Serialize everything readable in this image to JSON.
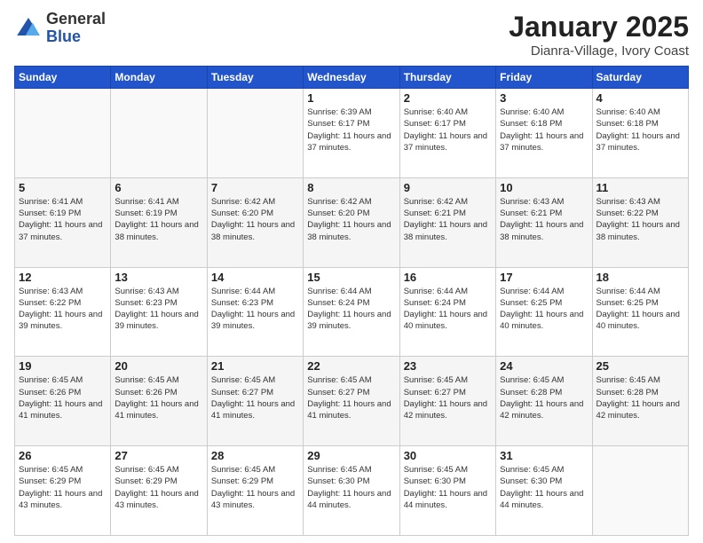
{
  "logo": {
    "general": "General",
    "blue": "Blue"
  },
  "header": {
    "month": "January 2025",
    "location": "Dianra-Village, Ivory Coast"
  },
  "days_of_week": [
    "Sunday",
    "Monday",
    "Tuesday",
    "Wednesday",
    "Thursday",
    "Friday",
    "Saturday"
  ],
  "weeks": [
    [
      {
        "day": "",
        "info": ""
      },
      {
        "day": "",
        "info": ""
      },
      {
        "day": "",
        "info": ""
      },
      {
        "day": "1",
        "info": "Sunrise: 6:39 AM\nSunset: 6:17 PM\nDaylight: 11 hours\nand 37 minutes."
      },
      {
        "day": "2",
        "info": "Sunrise: 6:40 AM\nSunset: 6:17 PM\nDaylight: 11 hours\nand 37 minutes."
      },
      {
        "day": "3",
        "info": "Sunrise: 6:40 AM\nSunset: 6:18 PM\nDaylight: 11 hours\nand 37 minutes."
      },
      {
        "day": "4",
        "info": "Sunrise: 6:40 AM\nSunset: 6:18 PM\nDaylight: 11 hours\nand 37 minutes."
      }
    ],
    [
      {
        "day": "5",
        "info": "Sunrise: 6:41 AM\nSunset: 6:19 PM\nDaylight: 11 hours\nand 37 minutes."
      },
      {
        "day": "6",
        "info": "Sunrise: 6:41 AM\nSunset: 6:19 PM\nDaylight: 11 hours\nand 38 minutes."
      },
      {
        "day": "7",
        "info": "Sunrise: 6:42 AM\nSunset: 6:20 PM\nDaylight: 11 hours\nand 38 minutes."
      },
      {
        "day": "8",
        "info": "Sunrise: 6:42 AM\nSunset: 6:20 PM\nDaylight: 11 hours\nand 38 minutes."
      },
      {
        "day": "9",
        "info": "Sunrise: 6:42 AM\nSunset: 6:21 PM\nDaylight: 11 hours\nand 38 minutes."
      },
      {
        "day": "10",
        "info": "Sunrise: 6:43 AM\nSunset: 6:21 PM\nDaylight: 11 hours\nand 38 minutes."
      },
      {
        "day": "11",
        "info": "Sunrise: 6:43 AM\nSunset: 6:22 PM\nDaylight: 11 hours\nand 38 minutes."
      }
    ],
    [
      {
        "day": "12",
        "info": "Sunrise: 6:43 AM\nSunset: 6:22 PM\nDaylight: 11 hours\nand 39 minutes."
      },
      {
        "day": "13",
        "info": "Sunrise: 6:43 AM\nSunset: 6:23 PM\nDaylight: 11 hours\nand 39 minutes."
      },
      {
        "day": "14",
        "info": "Sunrise: 6:44 AM\nSunset: 6:23 PM\nDaylight: 11 hours\nand 39 minutes."
      },
      {
        "day": "15",
        "info": "Sunrise: 6:44 AM\nSunset: 6:24 PM\nDaylight: 11 hours\nand 39 minutes."
      },
      {
        "day": "16",
        "info": "Sunrise: 6:44 AM\nSunset: 6:24 PM\nDaylight: 11 hours\nand 40 minutes."
      },
      {
        "day": "17",
        "info": "Sunrise: 6:44 AM\nSunset: 6:25 PM\nDaylight: 11 hours\nand 40 minutes."
      },
      {
        "day": "18",
        "info": "Sunrise: 6:44 AM\nSunset: 6:25 PM\nDaylight: 11 hours\nand 40 minutes."
      }
    ],
    [
      {
        "day": "19",
        "info": "Sunrise: 6:45 AM\nSunset: 6:26 PM\nDaylight: 11 hours\nand 41 minutes."
      },
      {
        "day": "20",
        "info": "Sunrise: 6:45 AM\nSunset: 6:26 PM\nDaylight: 11 hours\nand 41 minutes."
      },
      {
        "day": "21",
        "info": "Sunrise: 6:45 AM\nSunset: 6:27 PM\nDaylight: 11 hours\nand 41 minutes."
      },
      {
        "day": "22",
        "info": "Sunrise: 6:45 AM\nSunset: 6:27 PM\nDaylight: 11 hours\nand 41 minutes."
      },
      {
        "day": "23",
        "info": "Sunrise: 6:45 AM\nSunset: 6:27 PM\nDaylight: 11 hours\nand 42 minutes."
      },
      {
        "day": "24",
        "info": "Sunrise: 6:45 AM\nSunset: 6:28 PM\nDaylight: 11 hours\nand 42 minutes."
      },
      {
        "day": "25",
        "info": "Sunrise: 6:45 AM\nSunset: 6:28 PM\nDaylight: 11 hours\nand 42 minutes."
      }
    ],
    [
      {
        "day": "26",
        "info": "Sunrise: 6:45 AM\nSunset: 6:29 PM\nDaylight: 11 hours\nand 43 minutes."
      },
      {
        "day": "27",
        "info": "Sunrise: 6:45 AM\nSunset: 6:29 PM\nDaylight: 11 hours\nand 43 minutes."
      },
      {
        "day": "28",
        "info": "Sunrise: 6:45 AM\nSunset: 6:29 PM\nDaylight: 11 hours\nand 43 minutes."
      },
      {
        "day": "29",
        "info": "Sunrise: 6:45 AM\nSunset: 6:30 PM\nDaylight: 11 hours\nand 44 minutes."
      },
      {
        "day": "30",
        "info": "Sunrise: 6:45 AM\nSunset: 6:30 PM\nDaylight: 11 hours\nand 44 minutes."
      },
      {
        "day": "31",
        "info": "Sunrise: 6:45 AM\nSunset: 6:30 PM\nDaylight: 11 hours\nand 44 minutes."
      },
      {
        "day": "",
        "info": ""
      }
    ]
  ]
}
